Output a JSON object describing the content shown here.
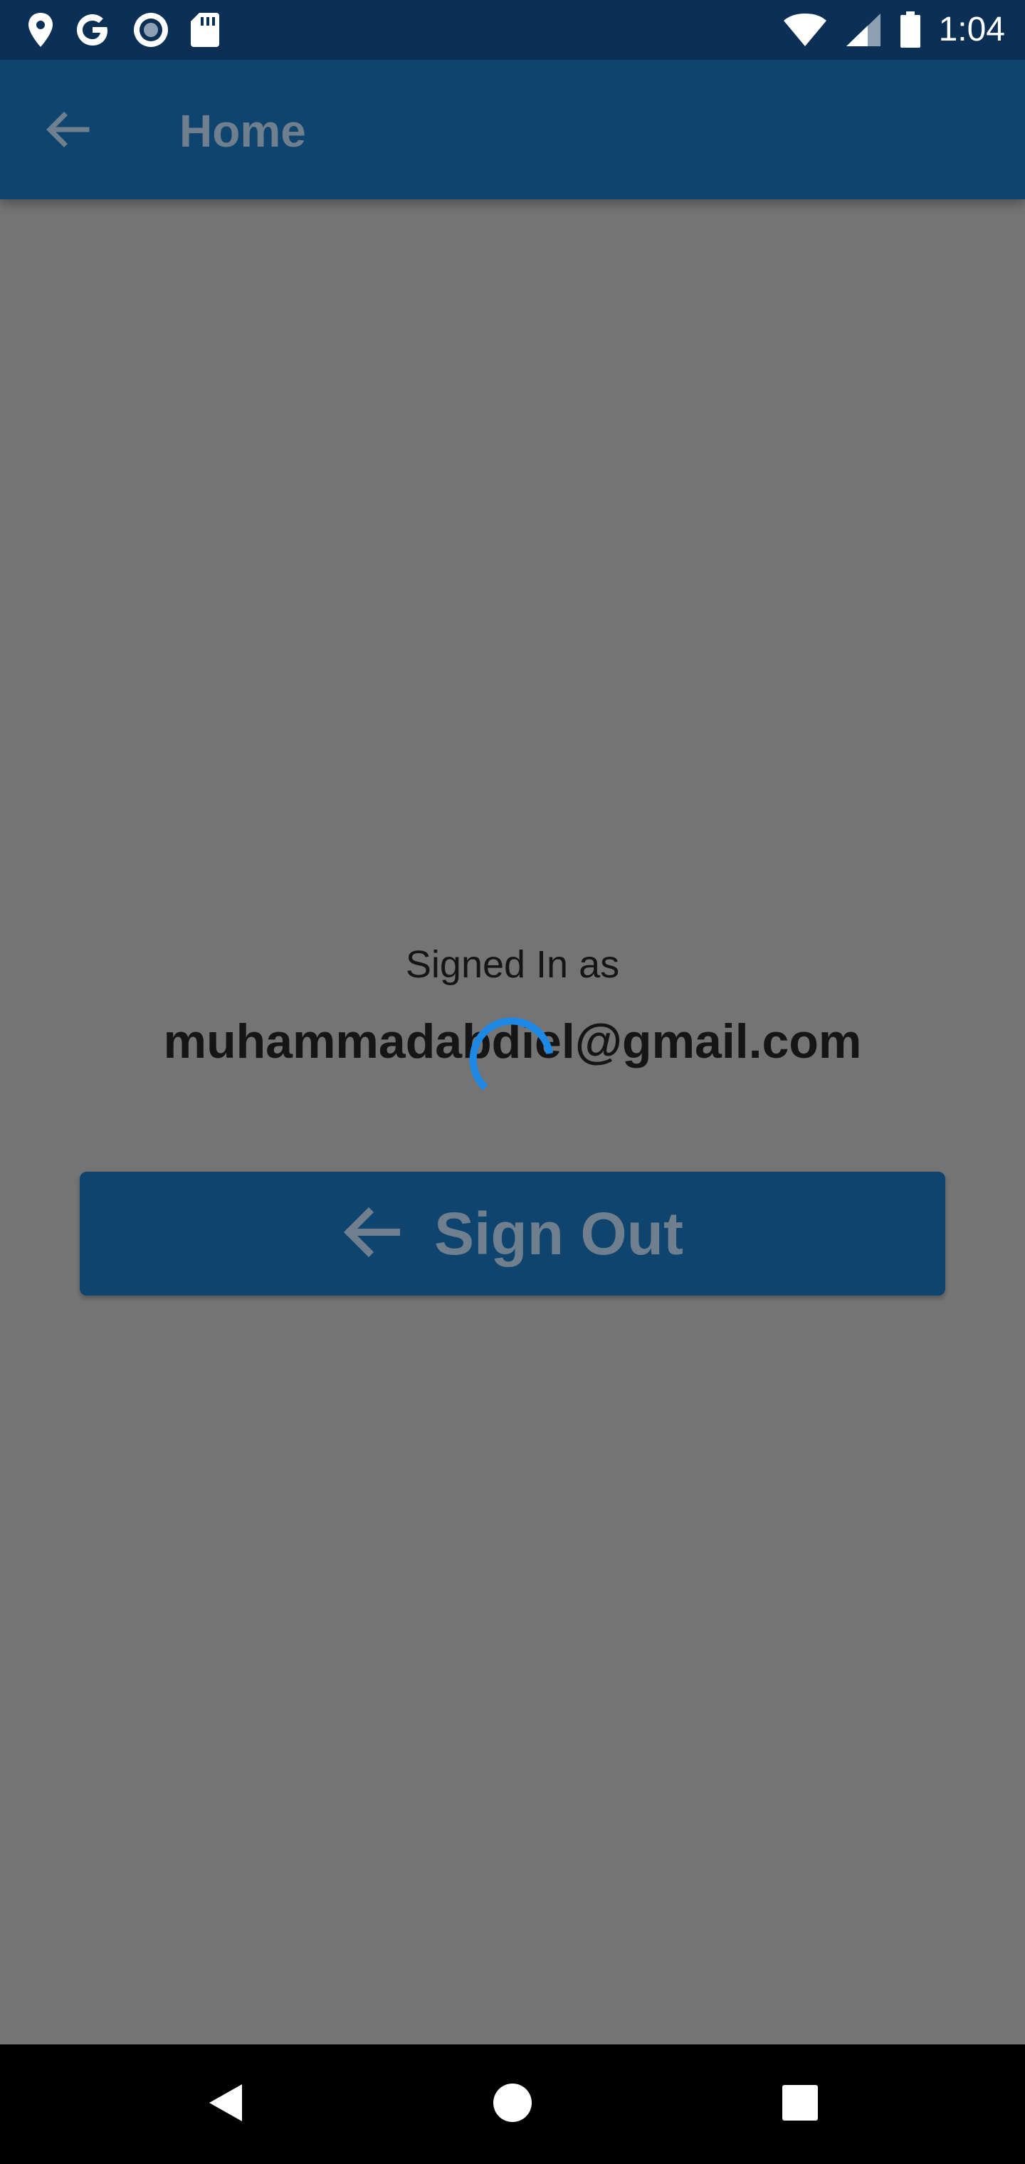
{
  "status_bar": {
    "time": "1:04",
    "left_icons": [
      "location-pin-icon",
      "google-g-icon",
      "record-icon",
      "sd-card-icon"
    ],
    "right_icons": [
      "wifi-icon",
      "cell-signal-icon",
      "battery-icon"
    ]
  },
  "app_bar": {
    "title": "Home",
    "back_icon": "arrow-left-icon"
  },
  "main": {
    "signed_in_label": "Signed In as",
    "email": "muhammadabdiel@gmail.com",
    "loading": true
  },
  "signout_button": {
    "label": "Sign Out",
    "icon": "arrow-left-icon"
  },
  "nav_bar": {
    "buttons": [
      "back-triangle-icon",
      "home-circle-icon",
      "recents-square-icon"
    ]
  },
  "colors": {
    "status_bar": "#0b2f55",
    "app_bar": "#0f446f",
    "overlay_background": "#747474",
    "muted_text": "#6f7f8e",
    "spinner": "#1e88e5",
    "nav_bar": "#000000"
  }
}
